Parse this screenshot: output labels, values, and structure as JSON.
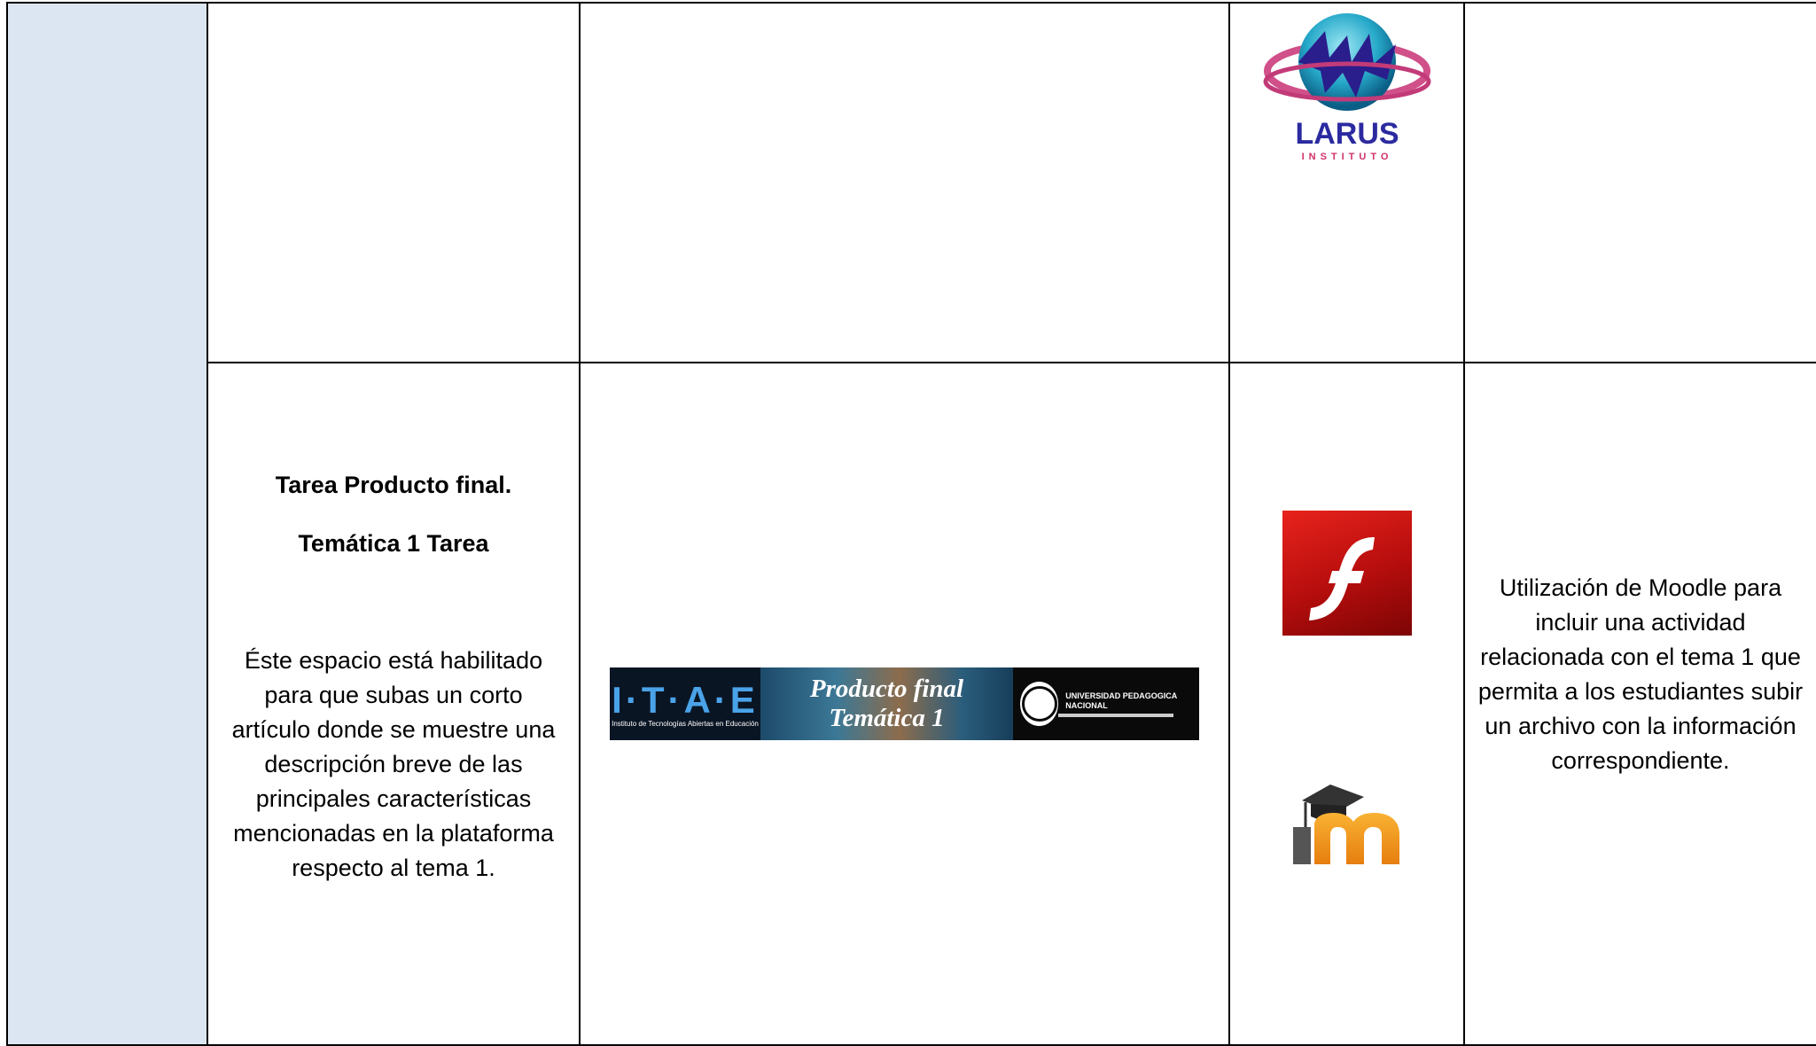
{
  "row1": {
    "logo_label": "LARUS",
    "logo_sublabel": "INSTITUTO"
  },
  "row2": {
    "task_title": "Tarea Producto final.",
    "task_subtitle": "Temática 1 Tarea",
    "task_description": "Éste espacio está habilitado para que subas un corto artículo donde  se muestre una descripción breve de las principales características mencionadas en la plataforma respecto al tema 1.",
    "banner": {
      "brand": "I·T·A·E",
      "brand_caption": "Instituto de Tecnologías Abiertas en Educación",
      "line1": "Producto final",
      "line2": "Temática 1",
      "university": "UNIVERSIDAD PEDAGOGICA NACIONAL"
    },
    "tools": [
      "flash-icon",
      "moodle-icon"
    ],
    "description": "Utilización de Moodle para incluir una actividad relacionada con el tema 1 que permita a los estudiantes subir un archivo con la información correspondiente."
  }
}
